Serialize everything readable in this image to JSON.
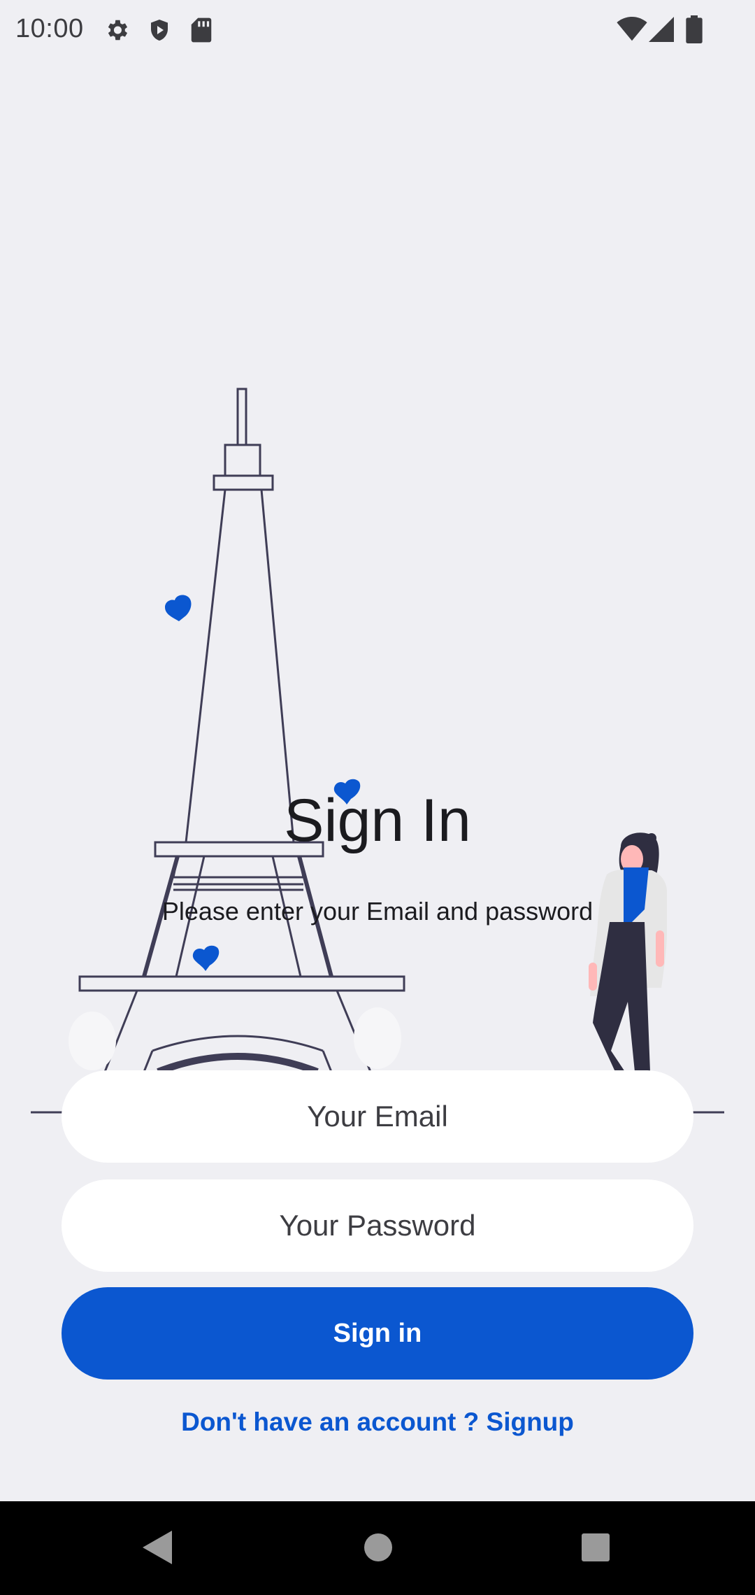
{
  "status_bar": {
    "time": "10:00",
    "left_icons": [
      "gear-icon",
      "shield-icon",
      "sd-card-icon"
    ],
    "right_icons": [
      "wifi-icon",
      "signal-icon",
      "battery-icon"
    ]
  },
  "illustration": {
    "subject": [
      "eiffel-tower-icon",
      "heart-icon",
      "person-figure-icon"
    ],
    "colors": {
      "line": "#3f3d56",
      "heart": "#0b57d0",
      "scarf": "#0b57d0",
      "coat": "#e6e6e6",
      "skin": "#ffb8b8"
    }
  },
  "header": {
    "title": "Sign In",
    "subtitle": "Please enter your Email and password"
  },
  "form": {
    "email_placeholder": "Your Email",
    "password_placeholder": "Your Password",
    "submit_label": "Sign in",
    "signup_text": "Don't have an account ? Signup"
  },
  "colors": {
    "background": "#efeff3",
    "accent": "#0b57d0",
    "field": "#ffffff",
    "nav_bar": "#000000"
  },
  "nav_bar": {
    "buttons": [
      "back-icon",
      "home-icon",
      "recents-icon"
    ]
  }
}
